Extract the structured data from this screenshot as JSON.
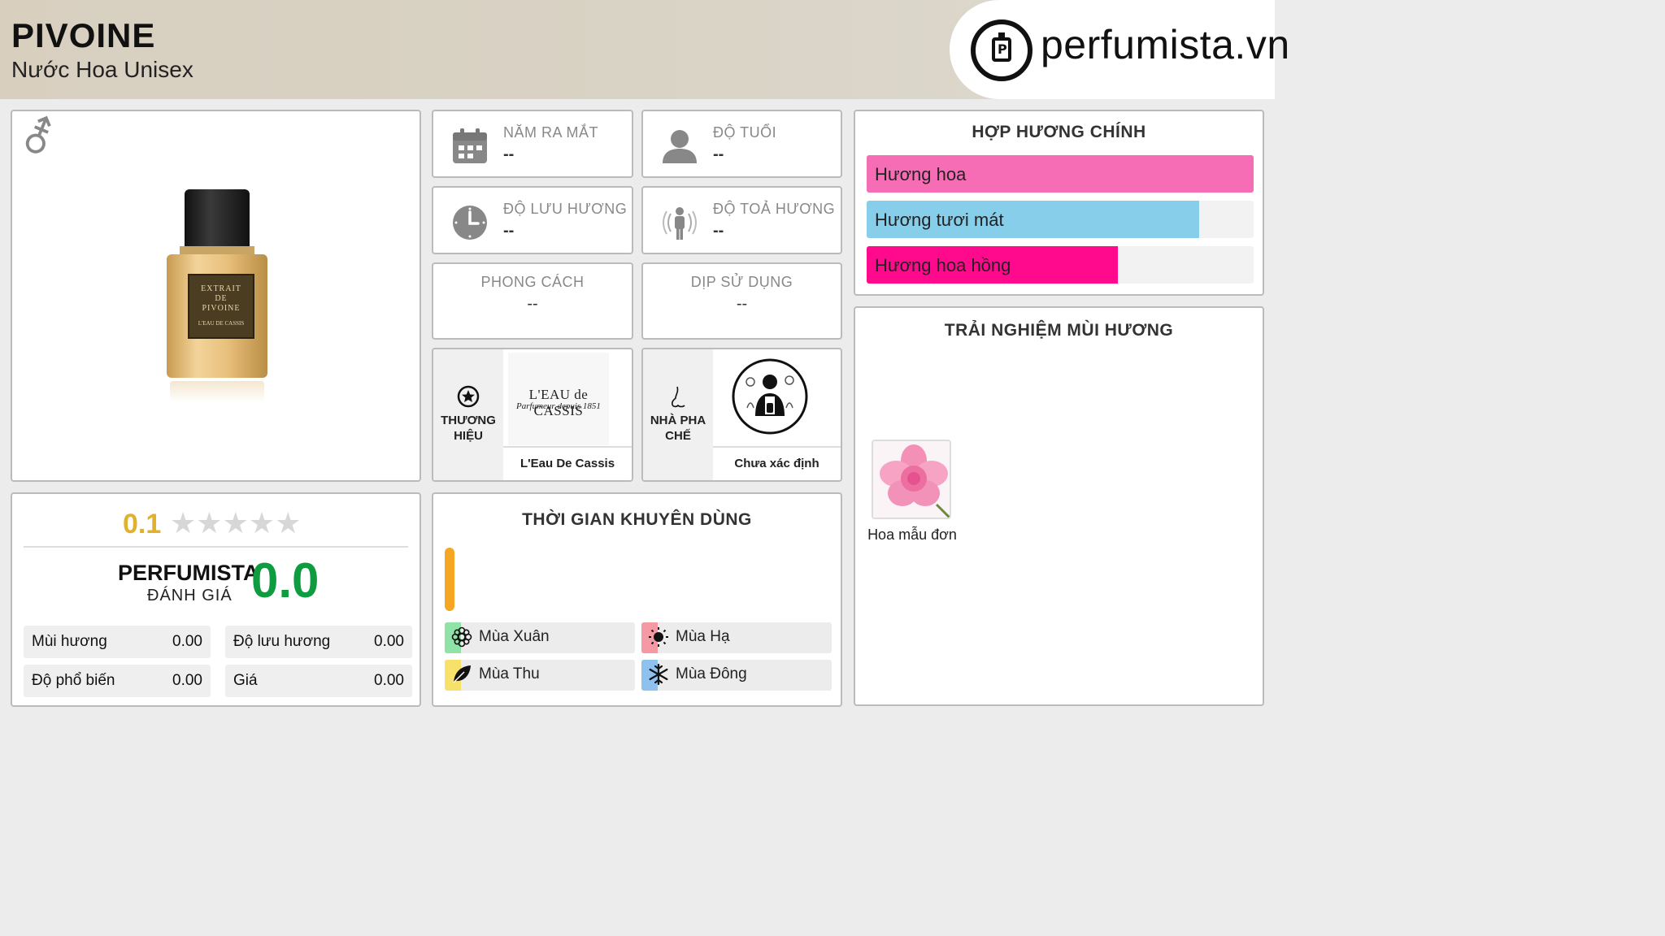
{
  "header": {
    "title": "PIVOINE",
    "subtitle": "Nước Hoa Unisex",
    "logo_text": "perfumista.vn",
    "logo_mark": "P"
  },
  "product": {
    "gender_icon": "unisex-icon",
    "bottle_label": [
      "EXTRAIT",
      "DE",
      "PIVOINE",
      "L'EAU DE CASSIS"
    ]
  },
  "info": {
    "release": {
      "label": "NĂM RA MẮT",
      "value": "--",
      "icon": "calendar-icon"
    },
    "age": {
      "label": "ĐỘ TUỔI",
      "value": "--",
      "icon": "person-icon"
    },
    "longevity": {
      "label": "ĐỘ LƯU HƯƠNG",
      "value": "--",
      "icon": "clock-icon"
    },
    "sillage": {
      "label": "ĐỘ TOẢ HƯƠNG",
      "value": "--",
      "icon": "radiating-person-icon"
    },
    "style": {
      "label": "PHONG CÁCH",
      "value": "--"
    },
    "occasion": {
      "label": "DỊP SỬ DỤNG",
      "value": "--"
    }
  },
  "brand": {
    "label": "THƯƠNG HIỆU",
    "logo_line1": "L'EAU de CASSIS",
    "logo_line2": "Parfumeur depuis 1851",
    "name": "L'Eau De Cassis"
  },
  "perfumer": {
    "label": "NHÀ PHA CHẾ",
    "name": "Chưa xác định"
  },
  "accords": {
    "title": "HỢP HƯƠNG CHÍNH",
    "items": [
      {
        "label": "Hương hoa",
        "level": 1.0,
        "color": "#f76db5"
      },
      {
        "label": "Hương tươi mát",
        "level": 0.86,
        "color": "#87ceeb"
      },
      {
        "label": "Hương hoa hồng",
        "level": 0.65,
        "color": "#ff0a8c"
      }
    ]
  },
  "experience": {
    "title": "TRẢI NGHIỆM MÙI HƯƠNG",
    "notes": [
      {
        "label": "Hoa mẫu đơn",
        "icon": "peony-flower-icon"
      }
    ]
  },
  "rating": {
    "user_score": "0.1",
    "stars_filled": 0,
    "stars_total": 5,
    "perfumista_label": "PERFUMISTA",
    "perfumista_sub": "ĐÁNH GIÁ",
    "perfumista_score": "0.0",
    "metrics": [
      {
        "label": "Mùi hương",
        "value": "0.00"
      },
      {
        "label": "Độ lưu hương",
        "value": "0.00"
      },
      {
        "label": "Độ phổ biến",
        "value": "0.00"
      },
      {
        "label": "Giá",
        "value": "0.00"
      }
    ]
  },
  "usage": {
    "title": "THỜI GIAN KHUYÊN DÙNG",
    "time_bar_color": "#f5a623",
    "seasons": [
      {
        "label": "Mùa Xuân",
        "color": "#8fe3a7",
        "icon": "spring-flower-icon"
      },
      {
        "label": "Mùa Hạ",
        "color": "#f59aa5",
        "icon": "sun-icon"
      },
      {
        "label": "Mùa Thu",
        "color": "#f7e16b",
        "icon": "leaf-icon"
      },
      {
        "label": "Mùa Đông",
        "color": "#8fc1ee",
        "icon": "snowflake-icon"
      }
    ]
  }
}
